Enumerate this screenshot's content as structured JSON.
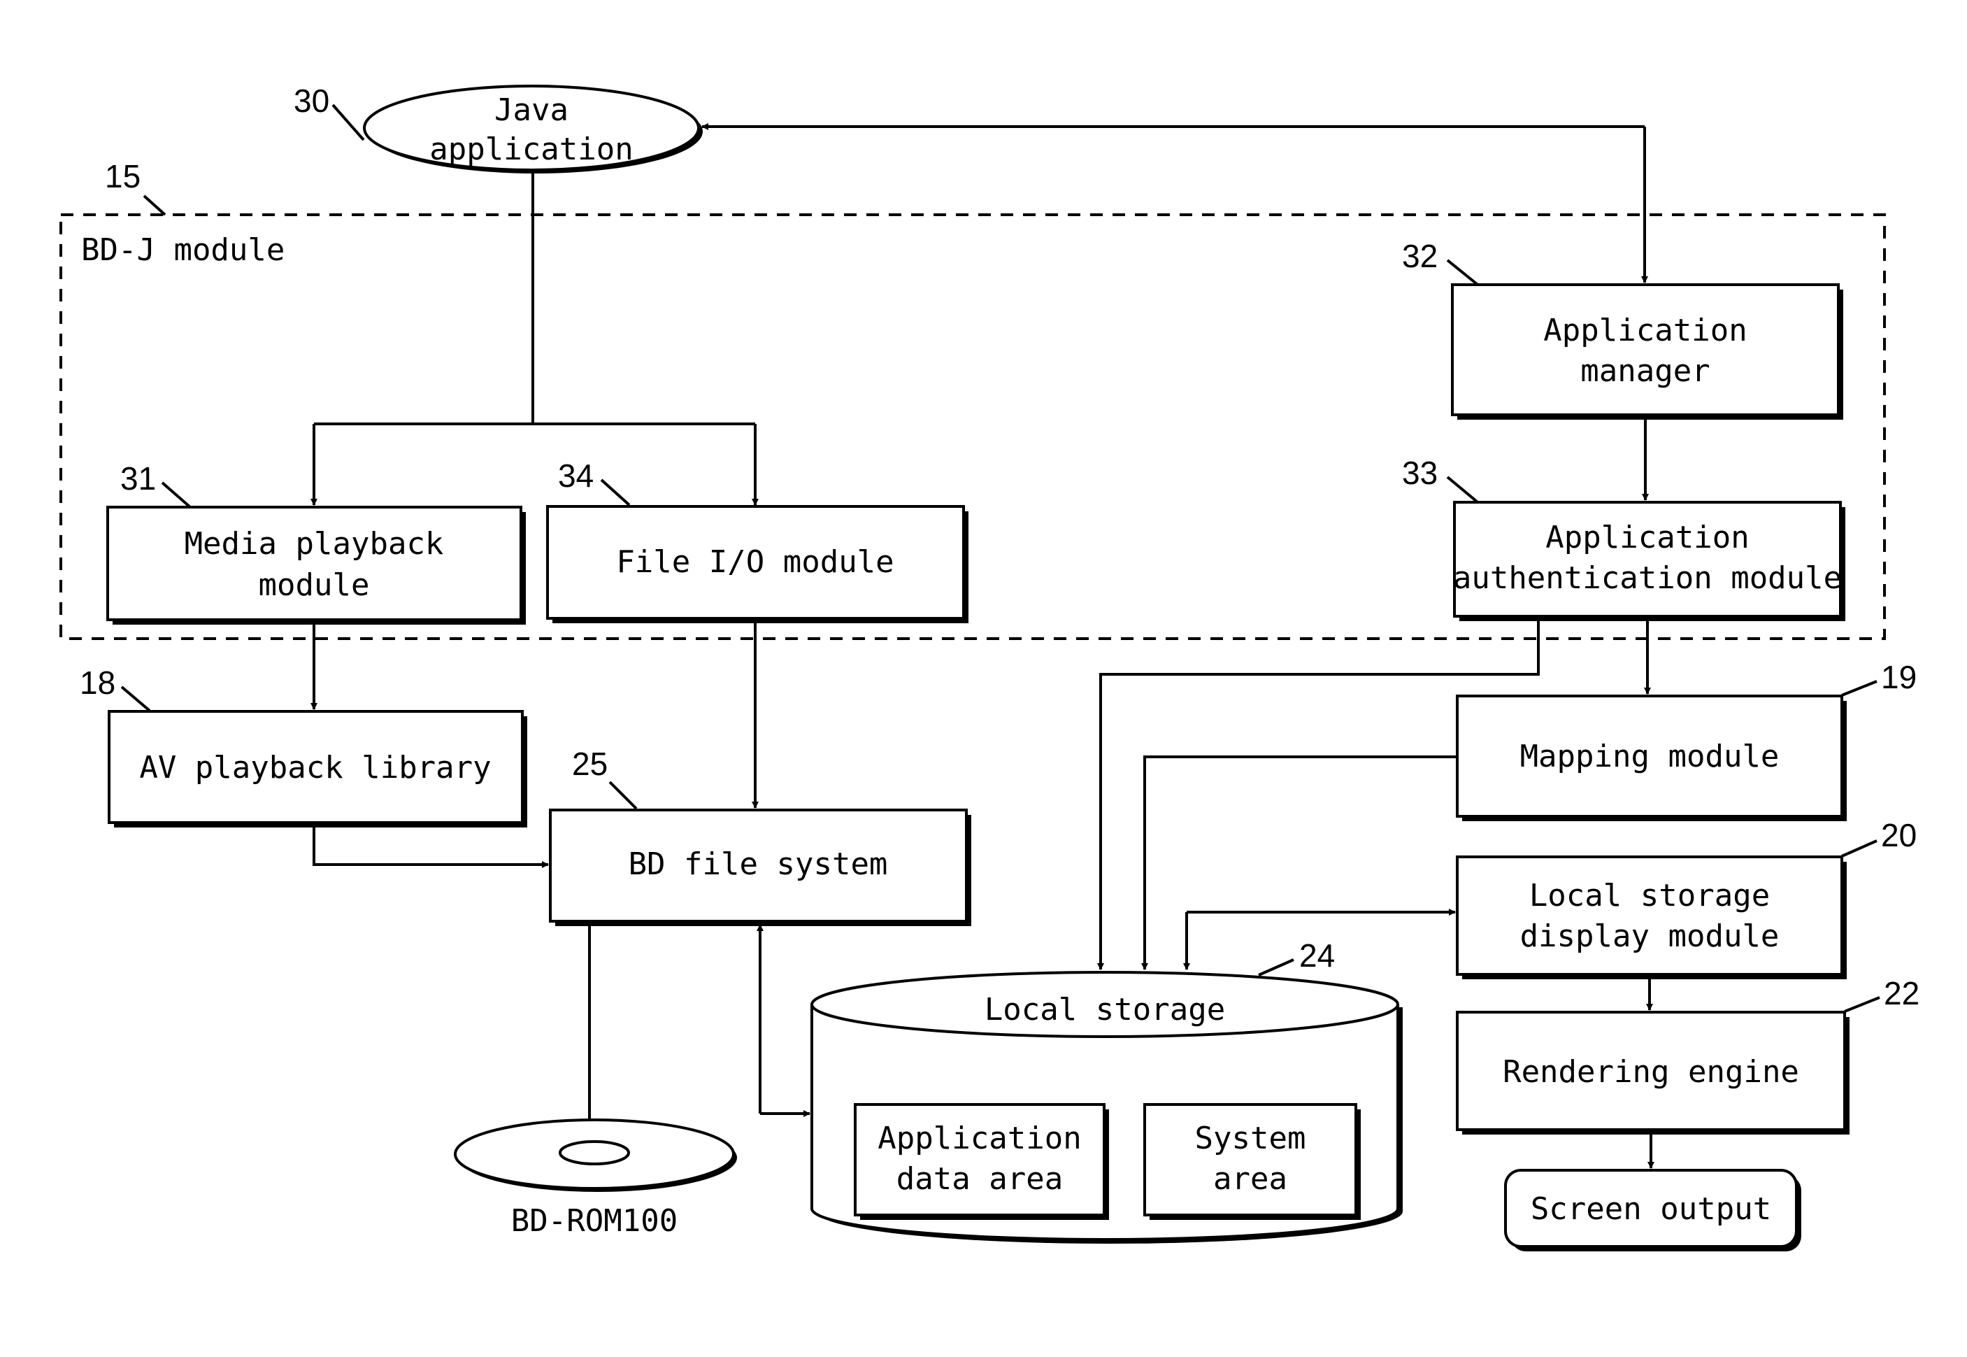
{
  "diagram": {
    "container": {
      "ref": "15",
      "label": "BD-J module"
    },
    "nodes": {
      "java_app": {
        "ref": "30",
        "lines": [
          "Java",
          "application"
        ]
      },
      "media_playback": {
        "ref": "31",
        "lines": [
          "Media playback",
          "module"
        ]
      },
      "file_io": {
        "ref": "34",
        "lines": [
          "File I/O module"
        ]
      },
      "app_manager": {
        "ref": "32",
        "lines": [
          "Application",
          "manager"
        ]
      },
      "app_auth": {
        "ref": "33",
        "lines": [
          "Application",
          "authentication module"
        ]
      },
      "av_library": {
        "ref": "18",
        "lines": [
          "AV playback library"
        ]
      },
      "bd_fs": {
        "ref": "25",
        "lines": [
          "BD file system"
        ]
      },
      "mapping": {
        "ref": "19",
        "lines": [
          "Mapping module"
        ]
      },
      "ls_display": {
        "ref": "20",
        "lines": [
          "Local storage",
          "display module"
        ]
      },
      "rendering": {
        "ref": "22",
        "lines": [
          "Rendering engine"
        ]
      },
      "screen_output": {
        "lines": [
          "Screen output"
        ]
      },
      "local_storage": {
        "ref": "24",
        "title": "Local storage",
        "areas": {
          "app_data": [
            "Application",
            "data area"
          ],
          "system": [
            "System",
            "area"
          ]
        }
      },
      "bd_rom": {
        "label": "BD-ROM100"
      }
    },
    "edges": [
      {
        "from": "java_app",
        "to": "media_playback"
      },
      {
        "from": "java_app",
        "to": "file_io"
      },
      {
        "from": "app_manager",
        "to": "java_app",
        "bidirectional": true
      },
      {
        "from": "app_manager",
        "to": "app_auth"
      },
      {
        "from": "media_playback",
        "to": "av_library"
      },
      {
        "from": "file_io",
        "to": "bd_fs"
      },
      {
        "from": "av_library",
        "to": "bd_fs"
      },
      {
        "from": "bd_fs",
        "to": "bd_rom"
      },
      {
        "from": "bd_fs",
        "to": "local_storage",
        "bidirectional": true
      },
      {
        "from": "app_auth",
        "to": "local_storage"
      },
      {
        "from": "app_auth",
        "to": "mapping"
      },
      {
        "from": "mapping",
        "to": "local_storage"
      },
      {
        "from": "local_storage",
        "to": "ls_display",
        "bidirectional": true
      },
      {
        "from": "ls_display",
        "to": "rendering"
      },
      {
        "from": "rendering",
        "to": "screen_output"
      }
    ]
  }
}
